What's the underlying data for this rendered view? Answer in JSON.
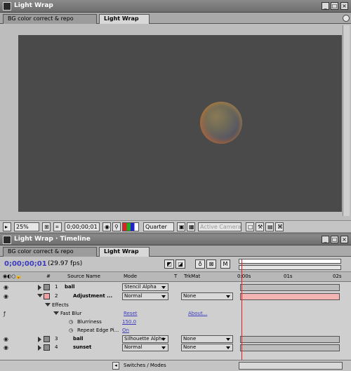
{
  "comp_window": {
    "title": "Light Wrap",
    "tabs": [
      {
        "label": "BG color correct & repo"
      },
      {
        "label": "Light Wrap"
      }
    ],
    "footer": {
      "zoom": "25%",
      "timecode": "0;00;00;01",
      "resolution": "Quarter",
      "camera": "Active Camera"
    }
  },
  "timeline_window": {
    "title": "Light Wrap · Timeline",
    "tabs": [
      {
        "label": "BG color correct & repo"
      },
      {
        "label": "Light Wrap"
      }
    ],
    "timecode": "0;00;00;01",
    "fps": "(29.97 fps)",
    "columns": {
      "num": "#",
      "source": "Source Name",
      "mode": "Mode",
      "t": "T",
      "trkmat": "TrkMat"
    },
    "ruler": {
      "t0": "0:00s",
      "t1": "01s",
      "t2": "02s"
    },
    "layers": [
      {
        "num": "1",
        "name": "ball",
        "mode": "Stencil Alpha",
        "trkmat": "",
        "label_color": "#8c8c8c"
      },
      {
        "num": "2",
        "name": "Adjustment ...",
        "mode": "Normal",
        "trkmat": "None",
        "label_color": "#f0a0a0"
      },
      {
        "num": "3",
        "name": "ball",
        "mode": "Silhouette Alpha",
        "trkmat": "None",
        "label_color": "#8c8c8c"
      },
      {
        "num": "4",
        "name": "sunset",
        "mode": "Normal",
        "trkmat": "None",
        "label_color": "#8c8c8c"
      }
    ],
    "effects": {
      "label": "Effects",
      "effect_name": "Fast Blur",
      "reset": "Reset",
      "about": "About...",
      "params": [
        {
          "name": "Blurriness",
          "value": "150.0"
        },
        {
          "name": "Repeat Edge Pi...",
          "value": "On"
        }
      ]
    },
    "switches_label": "Switches / Modes"
  },
  "colors": {
    "timecode": "#3b3bbf",
    "adjustment_bar": "#f4b4b4",
    "current_time_indicator": "#e02020"
  }
}
